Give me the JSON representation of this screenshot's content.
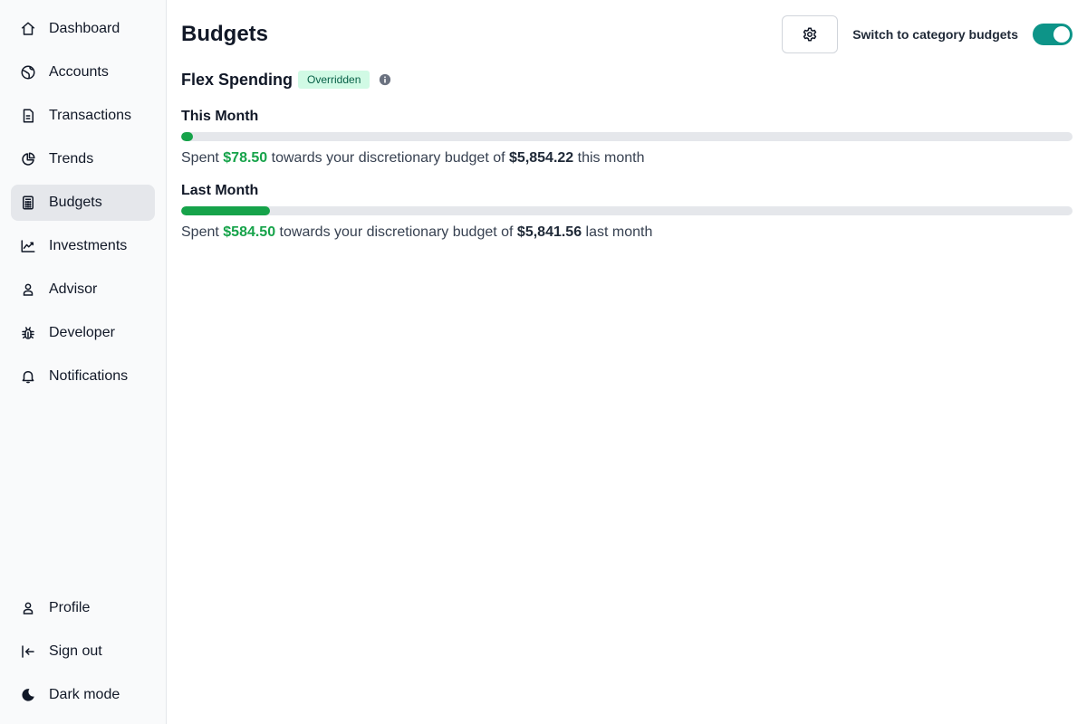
{
  "colors": {
    "accent": "#0d9488",
    "spent": "#16a34a",
    "track": "#e5e7eb"
  },
  "sidebar": {
    "items": [
      {
        "label": "Dashboard",
        "icon": "home-icon"
      },
      {
        "label": "Accounts",
        "icon": "globe-icon"
      },
      {
        "label": "Transactions",
        "icon": "document-icon"
      },
      {
        "label": "Trends",
        "icon": "pie-chart-icon"
      },
      {
        "label": "Budgets",
        "icon": "calculator-icon",
        "active": true
      },
      {
        "label": "Investments",
        "icon": "line-chart-icon"
      },
      {
        "label": "Advisor",
        "icon": "user-icon"
      },
      {
        "label": "Developer",
        "icon": "bug-icon"
      },
      {
        "label": "Notifications",
        "icon": "bell-icon"
      }
    ],
    "bottom_items": [
      {
        "label": "Profile",
        "icon": "user-icon"
      },
      {
        "label": "Sign out",
        "icon": "sign-out-icon"
      },
      {
        "label": "Dark mode",
        "icon": "moon-icon"
      }
    ]
  },
  "header": {
    "title": "Budgets",
    "settings_icon": "gear-icon",
    "toggle_label": "Switch to category budgets",
    "toggle_on": true
  },
  "flex": {
    "title": "Flex Spending",
    "badge": "Overridden",
    "info_icon": "info-icon"
  },
  "this_month": {
    "title": "This Month",
    "progress_percent": 1.34,
    "prefix": "Spent ",
    "spent": "$78.50",
    "middle": " towards your discretionary budget of ",
    "budget": "$5,854.22",
    "suffix": " this month"
  },
  "last_month": {
    "title": "Last Month",
    "progress_percent": 10.0,
    "prefix": "Spent ",
    "spent": "$584.50",
    "middle": " towards your discretionary budget of ",
    "budget": "$5,841.56",
    "suffix": " last month"
  }
}
